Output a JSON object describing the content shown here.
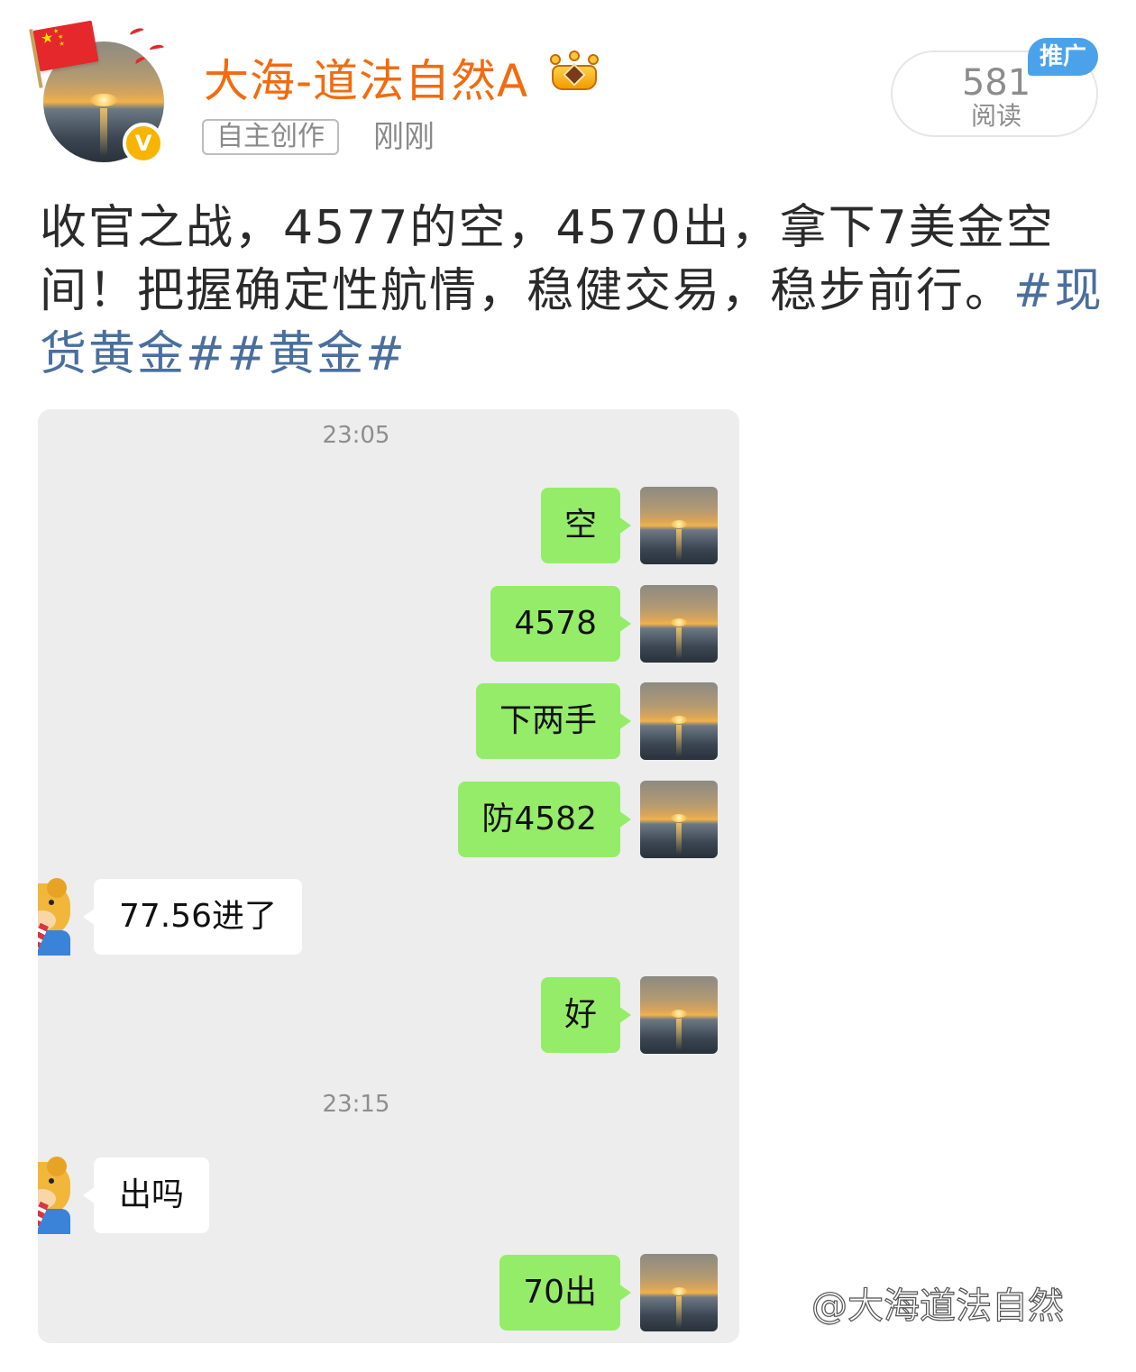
{
  "post_header": {
    "username": "大海-道法自然A",
    "source_tag": "自主创作",
    "time": "刚刚",
    "read_count": "581",
    "read_label": "阅读",
    "promo_label": "推广",
    "icons": [
      "china-flag-icon",
      "verified-v-icon",
      "crown-badge-icon"
    ]
  },
  "post": {
    "text": "收官之战，4577的空，4570出，拿下7美金空间！把握确定性航情，稳健交易，稳步前行。",
    "hashtags": [
      "#现货黄金#",
      "#黄金#"
    ]
  },
  "chat": {
    "messages": [
      {
        "type": "time",
        "text": "23:05"
      },
      {
        "type": "out",
        "text": "空"
      },
      {
        "type": "out",
        "text": "4578"
      },
      {
        "type": "out",
        "text": "下两手"
      },
      {
        "type": "out",
        "text": "防4582"
      },
      {
        "type": "in",
        "text": "77.56进了"
      },
      {
        "type": "out",
        "text": "好"
      },
      {
        "type": "time",
        "text": "23:15"
      },
      {
        "type": "in",
        "text": "出吗"
      },
      {
        "type": "out",
        "text": "70出"
      }
    ]
  },
  "watermark": "@大海道法自然",
  "colors": {
    "username": "#f26b0f",
    "hashtag": "#4a6f9e",
    "bubble_out": "#95ec69",
    "chat_bg": "#ededed",
    "promo": "#4aa3ea",
    "verified": "#f7b500"
  }
}
